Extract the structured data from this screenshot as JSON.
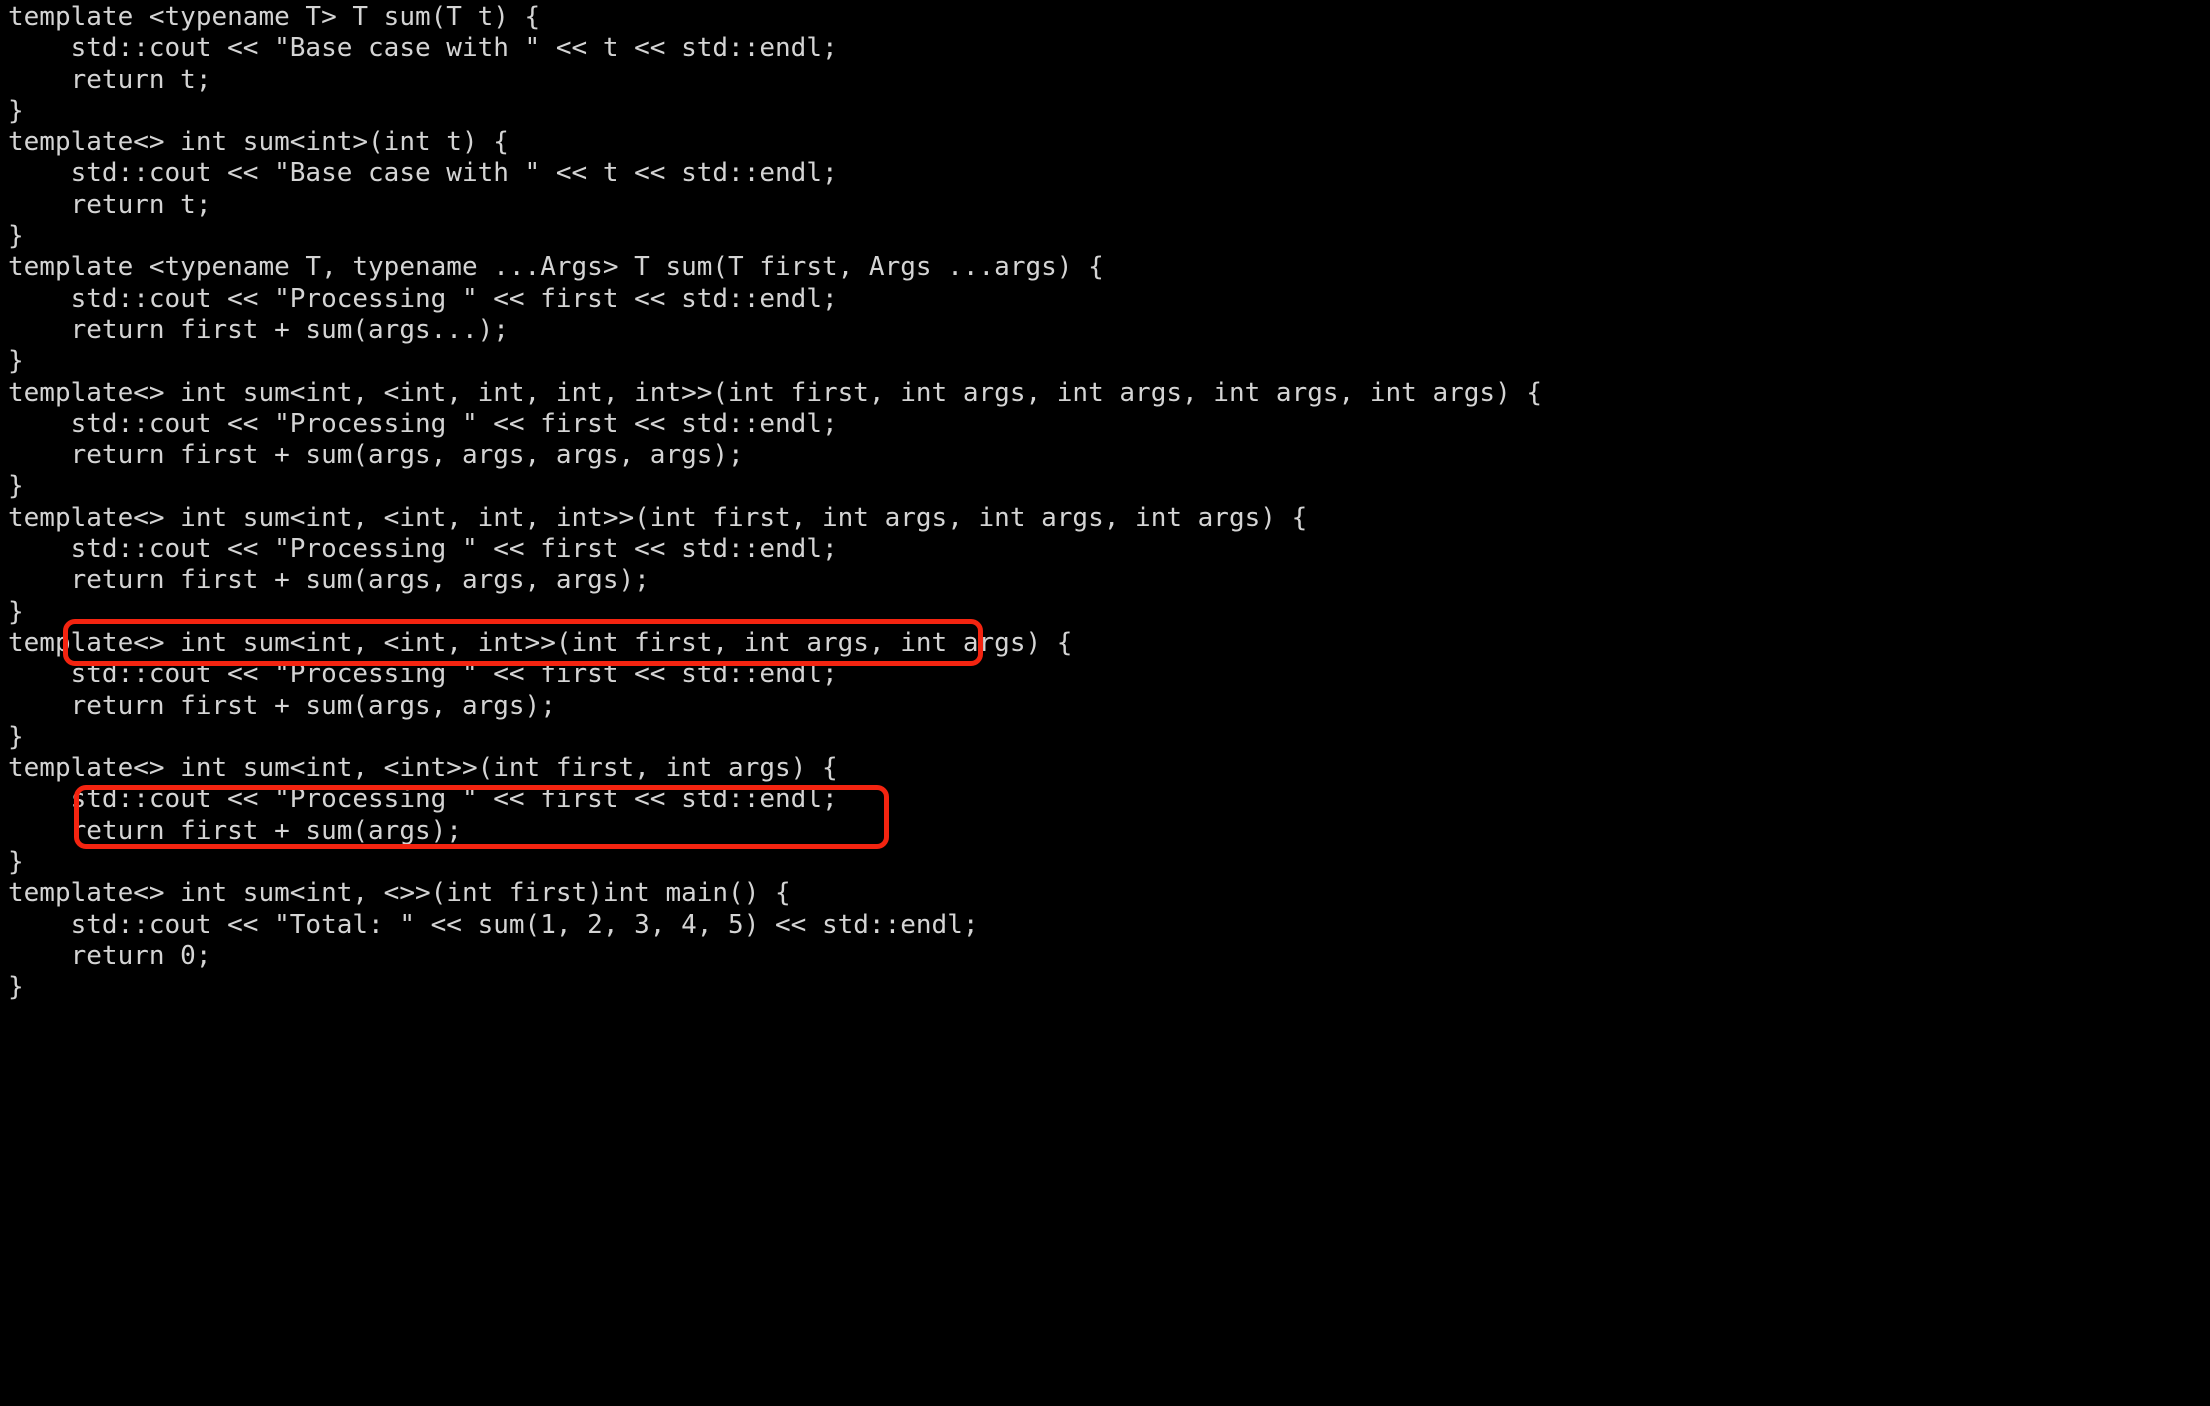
{
  "window": {
    "kind": "code-viewer",
    "background_color": "#000000",
    "text_color": "#d4d4d4",
    "annotation_color": "#f42410",
    "language": "cpp"
  },
  "code": {
    "lines": [
      "template <typename T> T sum(T t) {",
      "    std::cout << \"Base case with \" << t << std::endl;",
      "    return t;",
      "}",
      "template<> int sum<int>(int t) {",
      "    std::cout << \"Base case with \" << t << std::endl;",
      "    return t;",
      "}",
      "template <typename T, typename ...Args> T sum(T first, Args ...args) {",
      "    std::cout << \"Processing \" << first << std::endl;",
      "    return first + sum(args...);",
      "}",
      "template<> int sum<int, <int, int, int, int>>(int first, int args, int args, int args, int args) {",
      "    std::cout << \"Processing \" << first << std::endl;",
      "    return first + sum(args, args, args, args);",
      "}",
      "template<> int sum<int, <int, int, int>>(int first, int args, int args, int args) {",
      "    std::cout << \"Processing \" << first << std::endl;",
      "    return first + sum(args, args, args);",
      "}",
      "template<> int sum<int, <int, int>>(int first, int args, int args) {",
      "    std::cout << \"Processing \" << first << std::endl;",
      "    return first + sum(args, args);",
      "}",
      "template<> int sum<int, <int>>(int first, int args) {",
      "    std::cout << \"Processing \" << first << std::endl;",
      "    return first + sum(args);",
      "}",
      "template<> int sum<int, <>>(int first)int main() {",
      "    std::cout << \"Total: \" << sum(1, 2, 3, 4, 5) << std::endl;",
      "    return 0;",
      "}"
    ]
  },
  "annotations": [
    {
      "id": "annot-box-1",
      "shape": "rounded-rectangle",
      "color": "#f42410",
      "highlighted_text": "return first + sum(args, args, args, args);",
      "target_line_index": 14
    },
    {
      "id": "annot-box-2",
      "shape": "rounded-rectangle",
      "color": "#f42410",
      "highlighted_text": "return first + sum(args, args, args);",
      "target_line_index": 18
    }
  ]
}
